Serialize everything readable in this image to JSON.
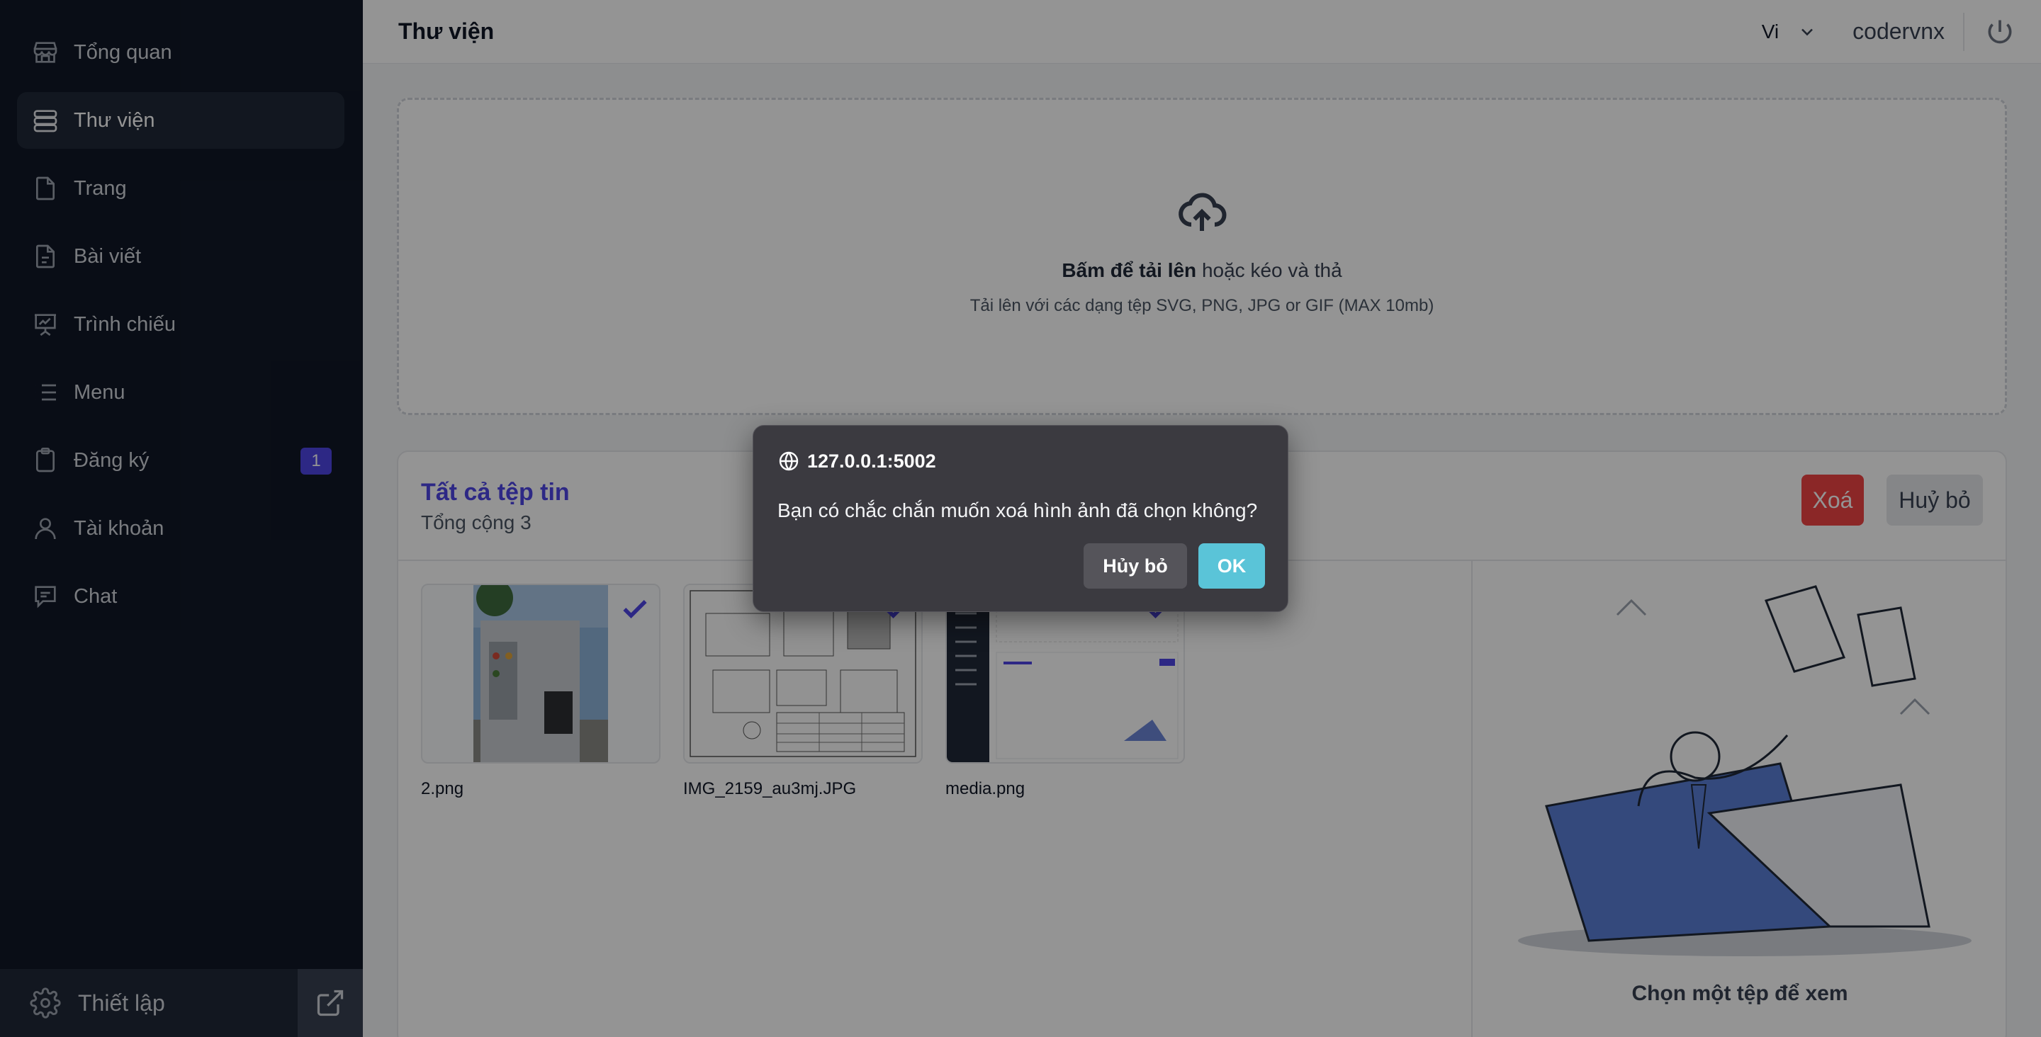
{
  "sidebar": {
    "items": [
      {
        "label": "Tổng quan",
        "icon": "store-icon"
      },
      {
        "label": "Thư viện",
        "icon": "database-icon",
        "active": true
      },
      {
        "label": "Trang",
        "icon": "file-icon"
      },
      {
        "label": "Bài viết",
        "icon": "file-text-icon"
      },
      {
        "label": "Trình chiếu",
        "icon": "presentation-icon"
      },
      {
        "label": "Menu",
        "icon": "list-icon"
      },
      {
        "label": "Đăng ký",
        "icon": "clipboard-icon",
        "badge": "1"
      },
      {
        "label": "Tài khoản",
        "icon": "user-icon"
      },
      {
        "label": "Chat",
        "icon": "chat-icon"
      }
    ],
    "footer": {
      "settings_label": "Thiết lập"
    }
  },
  "header": {
    "title": "Thư viện",
    "language": "Vi",
    "username": "codervnx"
  },
  "upload": {
    "action_bold": "Bấm để tải lên",
    "action_rest": " hoặc kéo và thả",
    "hint": "Tải lên với các dạng tệp SVG, PNG, JPG or GIF (MAX 10mb)"
  },
  "files_panel": {
    "title": "Tất cả tệp tin",
    "count_text": "Tổng cộng 3",
    "delete_label": "Xoá",
    "cancel_label": "Huỷ bỏ",
    "files": [
      {
        "name": "2.png",
        "selected": true
      },
      {
        "name": "IMG_2159_au3mj.JPG",
        "selected": true
      },
      {
        "name": "media.png",
        "selected": true
      }
    ],
    "preview_caption": "Chọn một tệp để xem"
  },
  "dialog": {
    "origin": "127.0.0.1:5002",
    "message": "Bạn có chắc chắn muốn xoá hình ảnh đã chọn không?",
    "cancel_label": "Hủy bỏ",
    "ok_label": "OK"
  },
  "colors": {
    "sidebar_bg": "#111827",
    "accent": "#4f46e5",
    "danger": "#ef4444",
    "dialog_bg": "#3b3a40",
    "dialog_ok": "#5ac4d8"
  }
}
